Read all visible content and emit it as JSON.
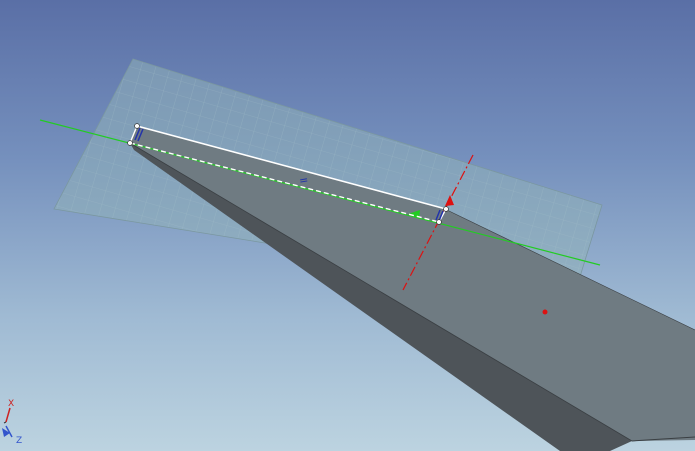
{
  "viewport": {
    "background_top": "#5a6fa6",
    "background_bottom": "#bcd3e0"
  },
  "sketch": {
    "constraint_symbol": "=",
    "line_color": "#ffffff",
    "plane_color": "#8fb0b8",
    "grid_color": "#a9c3c9"
  },
  "part": {
    "face_color": "#6f7b82",
    "side_color": "#4d5358"
  },
  "reference_axes": {
    "primary_color": "#22cc22",
    "secondary_color": "#dd1111"
  },
  "triad": {
    "x_label": "X",
    "z_label": "Z",
    "x_color": "#cc2222",
    "z_color": "#3355cc"
  }
}
